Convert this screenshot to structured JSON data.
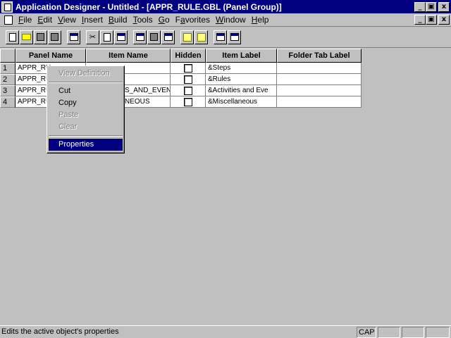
{
  "window": {
    "title": "Application Designer - Untitled - [APPR_RULE.GBL (Panel Group)]",
    "min_label": "_",
    "max_label": "▣",
    "close_label": "x"
  },
  "menu": {
    "items": [
      {
        "label": "File",
        "u": "F",
        "rest": "ile"
      },
      {
        "label": "Edit",
        "u": "E",
        "rest": "dit"
      },
      {
        "label": "View",
        "u": "V",
        "rest": "iew"
      },
      {
        "label": "Insert",
        "u": "I",
        "rest": "nsert"
      },
      {
        "label": "Build",
        "u": "B",
        "rest": "uild"
      },
      {
        "label": "Tools",
        "u": "T",
        "rest": "ools"
      },
      {
        "label": "Go",
        "u": "G",
        "rest": "o"
      },
      {
        "label": "Favorites",
        "u": "a",
        "pre": "F",
        "rest": "vorites"
      },
      {
        "label": "Window",
        "u": "W",
        "rest": "indow"
      },
      {
        "label": "Help",
        "u": "H",
        "rest": "elp"
      }
    ]
  },
  "grid": {
    "columns": [
      "Panel Name",
      "Item Name",
      "Hidden",
      "Item Label",
      "Folder Tab Label"
    ],
    "rows": [
      {
        "num": "1",
        "panel": "APPR_RU",
        "item": "",
        "label": "&Steps"
      },
      {
        "num": "2",
        "panel": "APPR_RU",
        "item": "",
        "label": "&Rules"
      },
      {
        "num": "3",
        "panel": "APPR_RU",
        "item": "S_AND_EVEN",
        "label": "&Activities and Eve"
      },
      {
        "num": "4",
        "panel": "APPR_RU",
        "item": "NEOUS",
        "label": "&Miscellaneous"
      }
    ]
  },
  "context_menu": {
    "view_definition": "View Definition",
    "cut": "Cut",
    "copy": "Copy",
    "paste": "Paste",
    "clear": "Clear",
    "properties": "Properties"
  },
  "status": {
    "text": "Edits the active object's properties",
    "cap": "CAP"
  },
  "colors": {
    "titlebar": "#000080",
    "face": "#c0c0c0",
    "selection": "#000080"
  }
}
